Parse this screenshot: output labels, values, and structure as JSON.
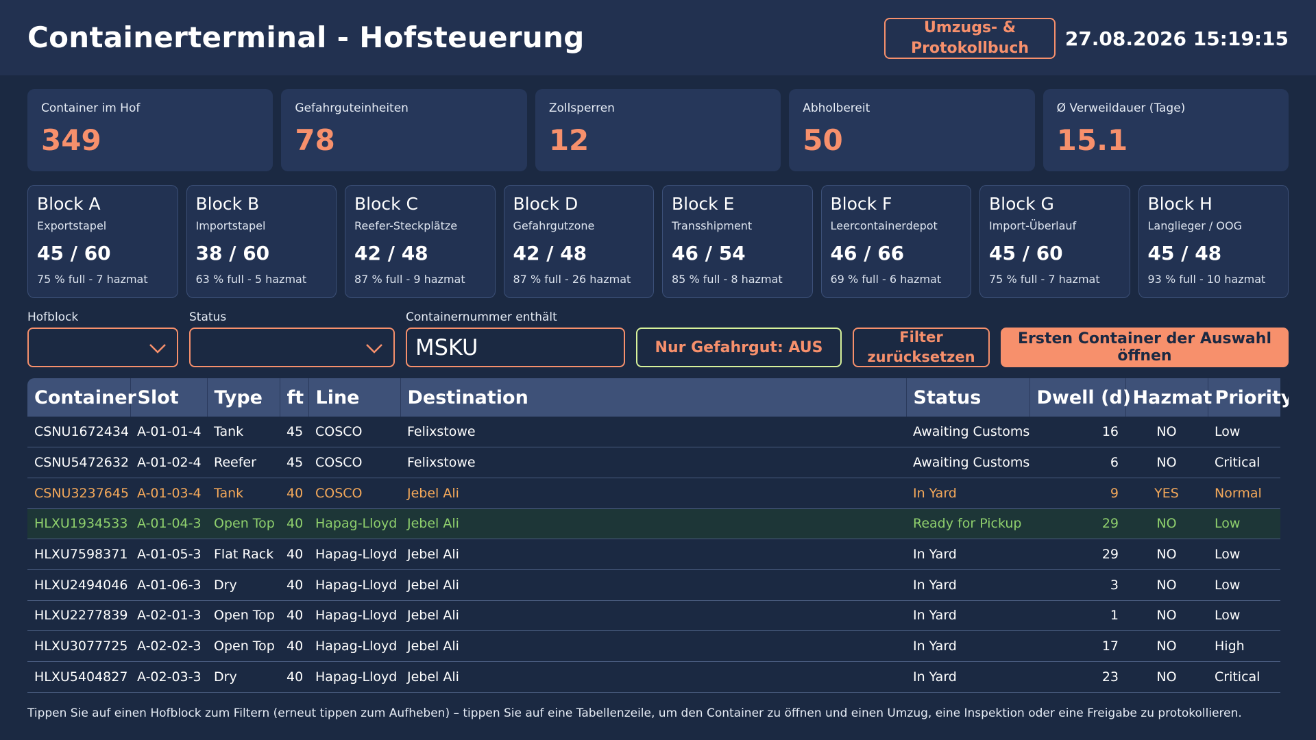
{
  "header": {
    "title": "Containerterminal - Hofsteuerung",
    "log_button": "Umzugs- & Protokollbuch",
    "datetime": "27.08.2026 15:19:15"
  },
  "kpis": [
    {
      "label": "Container im Hof",
      "value": "349"
    },
    {
      "label": "Gefahrguteinheiten",
      "value": "78"
    },
    {
      "label": "Zollsperren",
      "value": "12"
    },
    {
      "label": "Abholbereit",
      "value": "50"
    },
    {
      "label": "Ø Verweildauer (Tage)",
      "value": "15.1"
    }
  ],
  "blocks": [
    {
      "name": "Block A",
      "desc": "Exportstapel",
      "count": "45 / 60",
      "info": "75 % full - 7 hazmat"
    },
    {
      "name": "Block B",
      "desc": "Importstapel",
      "count": "38 / 60",
      "info": "63 % full - 5 hazmat"
    },
    {
      "name": "Block C",
      "desc": "Reefer-Steckplätze",
      "count": "42 / 48",
      "info": "87 % full - 9 hazmat"
    },
    {
      "name": "Block D",
      "desc": "Gefahrgutzone",
      "count": "42 / 48",
      "info": "87 % full - 26 hazmat"
    },
    {
      "name": "Block E",
      "desc": "Transshipment",
      "count": "46 / 54",
      "info": "85 % full - 8 hazmat"
    },
    {
      "name": "Block F",
      "desc": "Leercontainerdepot",
      "count": "46 / 66",
      "info": "69 % full - 6 hazmat"
    },
    {
      "name": "Block G",
      "desc": "Import-Überlauf",
      "count": "45 / 60",
      "info": "75 % full - 7 hazmat"
    },
    {
      "name": "Block H",
      "desc": "Langlieger / OOG",
      "count": "45 / 48",
      "info": "93 % full - 10 hazmat"
    }
  ],
  "filters": {
    "block_label": "Hofblock",
    "block_value": "",
    "status_label": "Status",
    "status_value": "",
    "container_label": "Containernummer enthält",
    "container_value": "MSKU",
    "hazmat_toggle": "Nur Gefahrgut: AUS",
    "reset_button": "Filter zurücksetzen",
    "open_button": "Ersten Container der Auswahl öffnen"
  },
  "table": {
    "columns": [
      "Container",
      "Slot",
      "Type",
      "ft",
      "Line",
      "Destination",
      "Status",
      "Dwell (d)",
      "Hazmat",
      "Priority"
    ],
    "rows": [
      {
        "state": "normal",
        "cells": [
          "CSNU1672434",
          "A-01-01-4",
          "Tank",
          "45",
          "COSCO",
          "Felixstowe",
          "Awaiting Customs",
          "16",
          "NO",
          "Low"
        ]
      },
      {
        "state": "normal",
        "cells": [
          "CSNU5472632",
          "A-01-02-4",
          "Reefer",
          "45",
          "COSCO",
          "Felixstowe",
          "Awaiting Customs",
          "6",
          "NO",
          "Critical"
        ]
      },
      {
        "state": "hazmat",
        "cells": [
          "CSNU3237645",
          "A-01-03-4",
          "Tank",
          "40",
          "COSCO",
          "Jebel Ali",
          "In Yard",
          "9",
          "YES",
          "Normal"
        ]
      },
      {
        "state": "ready",
        "cells": [
          "HLXU1934533",
          "A-01-04-3",
          "Open Top",
          "40",
          "Hapag-Lloyd",
          "Jebel Ali",
          "Ready for Pickup",
          "29",
          "NO",
          "Low"
        ]
      },
      {
        "state": "normal",
        "cells": [
          "HLXU7598371",
          "A-01-05-3",
          "Flat Rack",
          "40",
          "Hapag-Lloyd",
          "Jebel Ali",
          "In Yard",
          "29",
          "NO",
          "Low"
        ]
      },
      {
        "state": "normal",
        "cells": [
          "HLXU2494046",
          "A-01-06-3",
          "Dry",
          "40",
          "Hapag-Lloyd",
          "Jebel Ali",
          "In Yard",
          "3",
          "NO",
          "Low"
        ]
      },
      {
        "state": "normal",
        "cells": [
          "HLXU2277839",
          "A-02-01-3",
          "Open Top",
          "40",
          "Hapag-Lloyd",
          "Jebel Ali",
          "In Yard",
          "1",
          "NO",
          "Low"
        ]
      },
      {
        "state": "normal",
        "cells": [
          "HLXU3077725",
          "A-02-02-3",
          "Open Top",
          "40",
          "Hapag-Lloyd",
          "Jebel Ali",
          "In Yard",
          "17",
          "NO",
          "High"
        ]
      },
      {
        "state": "normal",
        "cells": [
          "HLXU5404827",
          "A-02-03-3",
          "Dry",
          "40",
          "Hapag-Lloyd",
          "Jebel Ali",
          "In Yard",
          "23",
          "NO",
          "Critical"
        ]
      }
    ]
  },
  "hint": "Tippen Sie auf einen Hofblock zum Filtern (erneut tippen zum Aufheben) – tippen Sie auf eine Tabellenzeile, um den Container zu öffnen und einen Umzug, eine Inspektion oder eine Freigabe zu protokollieren.",
  "colors": {
    "background": "#1b2942",
    "accent": "#f7906c",
    "hazmat_row": "#f5a95a",
    "ready_row": "#8fd06d",
    "toggle_border": "#d7f29b"
  }
}
